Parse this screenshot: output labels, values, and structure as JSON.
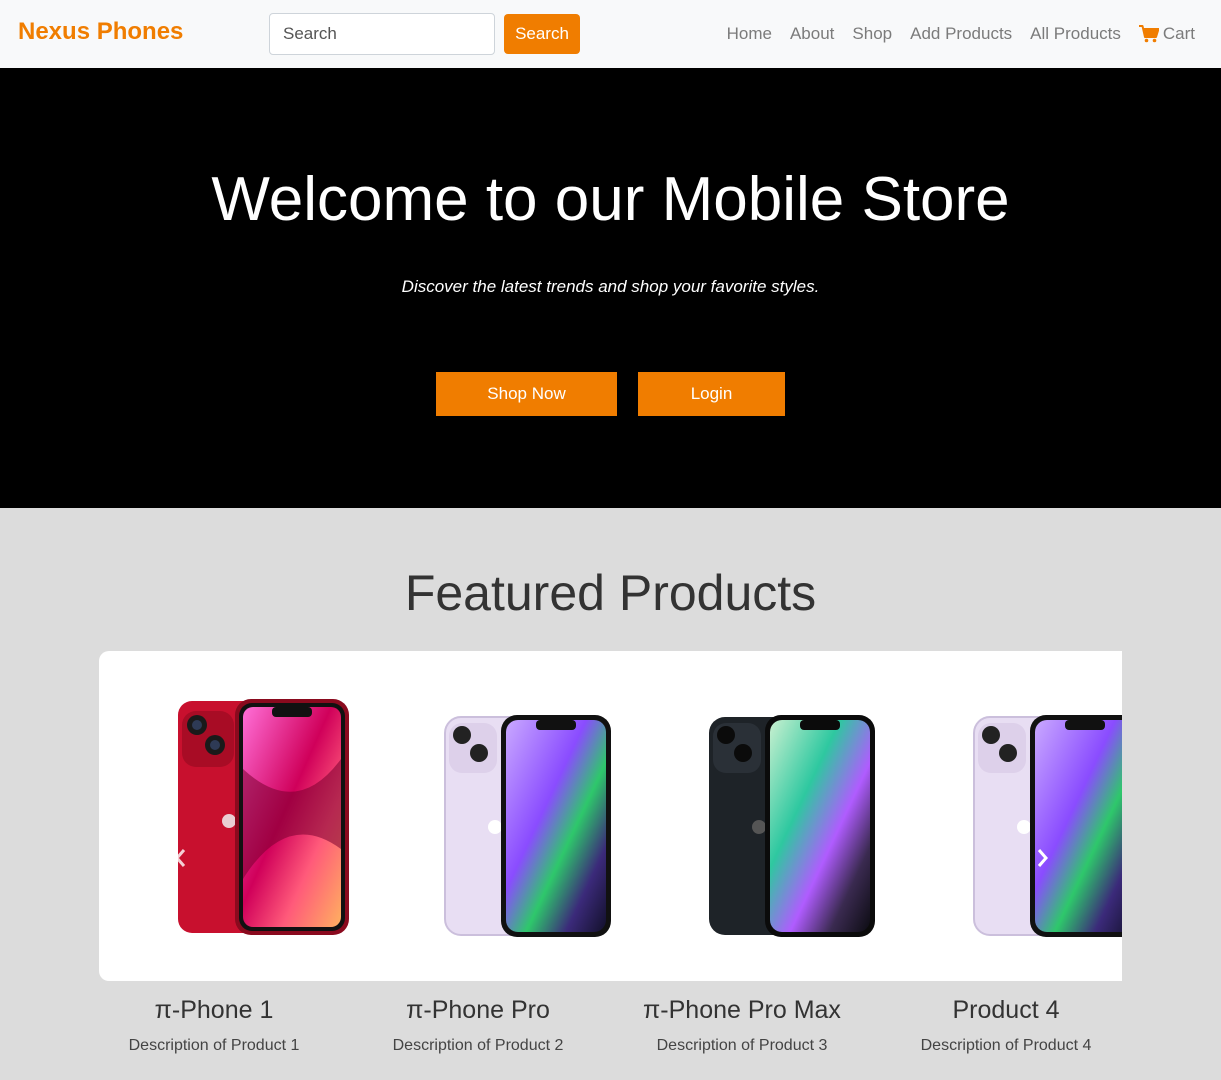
{
  "navbar": {
    "brand": "Nexus Phones",
    "search_placeholder": "Search",
    "search_button": "Search",
    "links": [
      "Home",
      "About",
      "Shop",
      "Add Products",
      "All Products"
    ],
    "cart_label": "Cart",
    "cart_icon": "cart-icon"
  },
  "hero": {
    "title": "Welcome to our Mobile Store",
    "subtitle": "Discover the latest trends and shop your favorite styles.",
    "shop_button": "Shop Now",
    "login_button": "Login"
  },
  "featured": {
    "title": "Featured Products",
    "products": [
      {
        "name": "π-Phone 1",
        "description": "Description of Product 1"
      },
      {
        "name": "π-Phone Pro",
        "description": "Description of Product 2"
      },
      {
        "name": "π-Phone Pro Max",
        "description": "Description of Product 3"
      },
      {
        "name": "Product 4",
        "description": "Description of Product 4"
      }
    ]
  },
  "colors": {
    "accent": "#f07d00",
    "hero_bg": "#000000",
    "section_bg": "#dcdcdc",
    "phone_red": "#c8102e",
    "phone_purple": "#e5dcef",
    "phone_midnight": "#1e2328"
  }
}
